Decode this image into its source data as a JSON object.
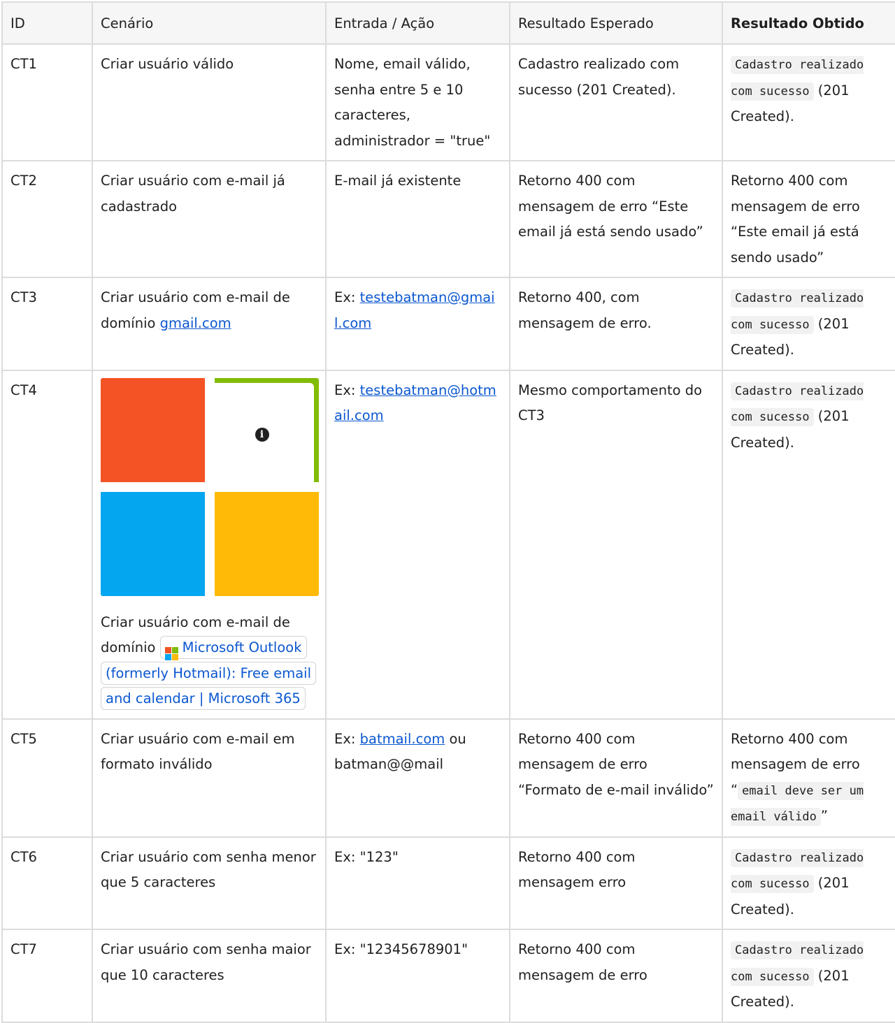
{
  "headers": [
    "ID",
    "Cenário",
    "Entrada / Ação",
    "Resultado Esperado",
    "Resultado Obtido"
  ],
  "rows": [
    {
      "id": "CT1",
      "scenario": "Criar usuário válido",
      "input": "Nome, email válido, senha entre 5 e 10 caracteres, administrador = \"true\"",
      "expected": "Cadastro realizado com sucesso (201 Created).",
      "obtained_code": "Cadastro realizado com sucesso",
      "obtained_suffix": " (201 Created)."
    },
    {
      "id": "CT2",
      "scenario": "Criar usuário com e-mail já cadastrado",
      "input": "E-mail já existente",
      "expected": "Retorno 400 com mensagem de erro “Este email já está sendo usado”",
      "obtained": "Retorno 400 com mensagem de erro “Este email já está sendo usado”"
    },
    {
      "id": "CT3",
      "scenario_prefix": "Criar usuário com e-mail de domínio ",
      "scenario_link": "gmail.com",
      "input_prefix": "Ex: ",
      "input_link": "testebatman@gmail.com",
      "expected": "Retorno 400, com mensagem de erro.",
      "obtained_code": "Cadastro realizado com sucesso",
      "obtained_suffix": " (201 Created)."
    },
    {
      "id": "CT4",
      "scenario_prefix": "Criar usuário com e-mail de domínio ",
      "scenario_chip": "Microsoft Outlook (formerly Hotmail): Free email and calendar | Microsoft 365",
      "input_prefix": "Ex: ",
      "input_link": "testebatman@hotmail.com",
      "expected": "Mesmo comportamento do CT3",
      "obtained_code": "Cadastro realizado com sucesso",
      "obtained_suffix": " (201 Created)."
    },
    {
      "id": "CT5",
      "scenario": "Criar usuário com e-mail em formato inválido",
      "input_prefix": "Ex: ",
      "input_link": "batmail.com",
      "input_suffix": " ou batman@@mail",
      "expected": "Retorno 400 com mensagem de erro “Formato de e-mail inválido”",
      "obtained_prefix": "Retorno 400 com mensagem de erro “",
      "obtained_code": "email deve ser um email válido",
      "obtained_suffix": "”"
    },
    {
      "id": "CT6",
      "scenario": "Criar usuário com senha menor que 5 caracteres",
      "input": "Ex: \"123\"",
      "expected": "Retorno 400 com mensagem erro",
      "obtained_code": "Cadastro realizado com sucesso",
      "obtained_suffix": " (201 Created)."
    },
    {
      "id": "CT7",
      "scenario": "Criar usuário com senha maior que 10 caracteres",
      "input": "Ex: \"12345678901\"",
      "expected": "Retorno 400 com mensagem de erro",
      "obtained_code": "Cadastro realizado com sucesso",
      "obtained_suffix": " (201 Created)."
    }
  ],
  "colors": {
    "ms_red": "#f35325",
    "ms_green": "#81bc06",
    "ms_blue": "#05a6f0",
    "ms_yellow": "#ffba08",
    "link": "#0b57d0"
  },
  "icons": {
    "microsoft_logo": "microsoft-logo-icon",
    "info": "info-icon"
  }
}
